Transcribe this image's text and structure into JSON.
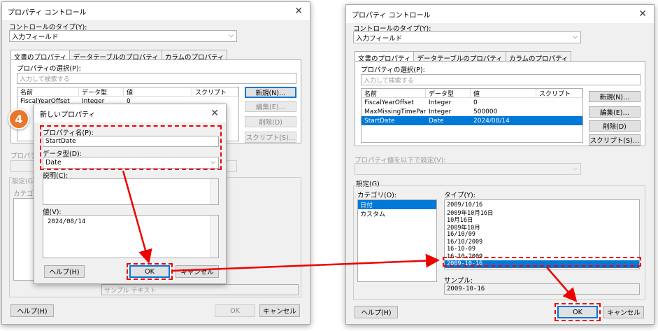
{
  "left": {
    "title": "プロパティ コントロール",
    "control_type_label": "コントロールのタイプ(Y):",
    "control_type_value": "入力フィールド",
    "tabs": [
      "文書のプロパティ",
      "データテーブルのプロパティ",
      "カラムのプロパティ"
    ],
    "select_label": "プロパティの選択(P):",
    "search_placeholder": "入力して検索する",
    "columns": [
      "名前",
      "データ型",
      "値",
      "スクリプト"
    ],
    "rows": [
      [
        "FiscalYearOffset",
        "Integer",
        "0",
        ""
      ]
    ],
    "buttons": {
      "new": "新規(N)…",
      "edit": "編集(E)…",
      "delete": "削除(D)",
      "script": "スクリプト(S)…"
    },
    "bg_prop_label": "プロパティ",
    "bg_settings_label": "設定(G",
    "bg_category_label": "カテゴリ(",
    "sample_text": "サンプル テキスト",
    "help": "ヘルプ(H)",
    "ok": "OK",
    "cancel": "キャンセル"
  },
  "badge": "4",
  "new_prop": {
    "title": "新しいプロパティ",
    "name_label": "プロパティ名(P):",
    "name_value": "StartDate",
    "type_label": "データ型(D):",
    "type_value": "Date",
    "desc_label": "説明(C):",
    "value_label": "値(V):",
    "value_value": "2024/08/14",
    "help": "ヘルプ(H)",
    "ok": "OK",
    "cancel": "キャンセル"
  },
  "right": {
    "title": "プロパティ コントロール",
    "control_type_label": "コントロールのタイプ(Y):",
    "control_type_value": "入力フィールド",
    "tabs": [
      "文書のプロパティ",
      "データテーブルのプロパティ",
      "カラムのプロパティ"
    ],
    "select_label": "プロパティの選択(P):",
    "search_placeholder": "入力して検索する",
    "columns": [
      "名前",
      "データ型",
      "値",
      "スクリプト"
    ],
    "rows": [
      [
        "FiscalYearOffset",
        "Integer",
        "0",
        ""
      ],
      [
        "MaxMissingTimePar…",
        "Integer",
        "500000",
        ""
      ],
      [
        "StartDate",
        "Date",
        "2024/08/14",
        ""
      ]
    ],
    "buttons": {
      "new": "新規(N)…",
      "edit": "編集(E)…",
      "delete": "削除(D)",
      "script": "スクリプト(S)…"
    },
    "set_value_label": "プロパティ値を以下で設定(V):",
    "settings_label": "設定(G)",
    "category_label": "カテゴリ(O):",
    "categories": [
      "日付",
      "カスタム"
    ],
    "type_label": "タイプ(Y):",
    "types": [
      "2009/10/16",
      "2009年10月16日",
      "10月16日",
      "2009年10月",
      "16/10/09",
      "16/10/2009",
      "16-10-09",
      "16-10-2009",
      "2009-10-16"
    ],
    "sample_label": "サンプル:",
    "sample_value": "2009-10-16",
    "help": "ヘルプ(H)",
    "ok": "OK",
    "cancel": "キャンセル"
  }
}
